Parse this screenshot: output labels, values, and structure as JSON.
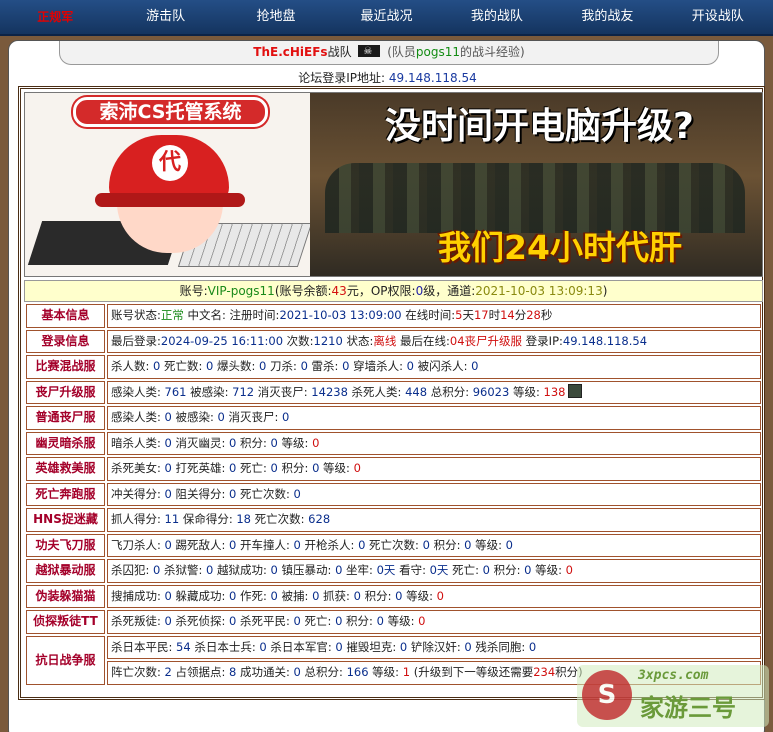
{
  "nav": [
    {
      "label": "正规军",
      "name": "nav-regular-army"
    },
    {
      "label": "游击队",
      "name": "nav-guerrilla"
    },
    {
      "label": "抢地盘",
      "name": "nav-territory"
    },
    {
      "label": "最近战况",
      "name": "nav-recent-battles"
    },
    {
      "label": "我的战队",
      "name": "nav-my-team"
    },
    {
      "label": "我的战友",
      "name": "nav-my-comrades"
    },
    {
      "label": "开设战队",
      "name": "nav-create-team"
    }
  ],
  "title": {
    "team_name": "ThE.cHiEFs",
    "team_word": "战队",
    "member_open": "(队员",
    "member": "pogs11",
    "member_close": "的战斗经验)"
  },
  "ip_line": {
    "label": "论坛登录IP地址:",
    "value": "49.148.118.54"
  },
  "banner": {
    "logo_text": "索沛CS托管系统",
    "hat_mark": "代",
    "headline": "没时间开电脑升级?",
    "subline": "我们24小时代肝"
  },
  "account": {
    "l1": "账号:",
    "acct": "VIP-pogs11",
    "l2": "(账号余额:",
    "bal": "43",
    "l3": "元，OP权限:",
    "op": "0",
    "l4": "级，通道:",
    "chan": "2021-10-03 13:09:13",
    "l5": ")"
  },
  "rows": [
    {
      "label": "基本信息",
      "parts": [
        {
          "t": "账号状态:",
          "c": ""
        },
        {
          "t": "正常",
          "c": "g"
        },
        {
          "t": " 中文名:  注册时间:",
          "c": ""
        },
        {
          "t": "2021-10-03 13:09:00",
          "c": "n"
        },
        {
          "t": " 在线时间:",
          "c": ""
        },
        {
          "t": "5",
          "c": "rd"
        },
        {
          "t": "天",
          "c": ""
        },
        {
          "t": "17",
          "c": "rd"
        },
        {
          "t": "时",
          "c": ""
        },
        {
          "t": "14",
          "c": "rd"
        },
        {
          "t": "分",
          "c": ""
        },
        {
          "t": "28",
          "c": "rd"
        },
        {
          "t": "秒",
          "c": ""
        }
      ]
    },
    {
      "label": "登录信息",
      "parts": [
        {
          "t": "最后登录:",
          "c": ""
        },
        {
          "t": "2024-09-25 16:11:00",
          "c": "n"
        },
        {
          "t": " 次数:",
          "c": ""
        },
        {
          "t": "1210",
          "c": "n"
        },
        {
          "t": " 状态:",
          "c": ""
        },
        {
          "t": "离线",
          "c": "rd"
        },
        {
          "t": " 最后在线:",
          "c": ""
        },
        {
          "t": "04丧尸升级服",
          "c": "rd"
        },
        {
          "t": " 登录IP:",
          "c": ""
        },
        {
          "t": "49.148.118.54",
          "c": "n"
        }
      ]
    },
    {
      "label": "比赛混战服",
      "parts": [
        {
          "t": "杀人数:",
          "c": ""
        },
        {
          "t": " 0",
          "c": "n"
        },
        {
          "t": " 死亡数:",
          "c": ""
        },
        {
          "t": " 0",
          "c": "n"
        },
        {
          "t": " 爆头数:",
          "c": ""
        },
        {
          "t": " 0",
          "c": "n"
        },
        {
          "t": " 刀杀:",
          "c": ""
        },
        {
          "t": " 0",
          "c": "n"
        },
        {
          "t": " 雷杀:",
          "c": ""
        },
        {
          "t": " 0",
          "c": "n"
        },
        {
          "t": " 穿墙杀人:",
          "c": ""
        },
        {
          "t": " 0",
          "c": "n"
        },
        {
          "t": " 被闪杀人:",
          "c": ""
        },
        {
          "t": " 0",
          "c": "n"
        }
      ]
    },
    {
      "label": "丧尸升级服",
      "avatar": true,
      "parts": [
        {
          "t": "感染人类:",
          "c": ""
        },
        {
          "t": " 761",
          "c": "n"
        },
        {
          "t": " 被感染:",
          "c": ""
        },
        {
          "t": " 712",
          "c": "n"
        },
        {
          "t": " 消灭丧尸:",
          "c": ""
        },
        {
          "t": " 14238",
          "c": "n"
        },
        {
          "t": " 杀死人类:",
          "c": ""
        },
        {
          "t": " 448",
          "c": "n"
        },
        {
          "t": " 总积分:",
          "c": ""
        },
        {
          "t": " 96023",
          "c": "n"
        },
        {
          "t": " 等级:",
          "c": ""
        },
        {
          "t": " 138",
          "c": "rd"
        }
      ]
    },
    {
      "label": "普通丧尸服",
      "parts": [
        {
          "t": "感染人类:",
          "c": ""
        },
        {
          "t": " 0",
          "c": "n"
        },
        {
          "t": " 被感染:",
          "c": ""
        },
        {
          "t": " 0",
          "c": "n"
        },
        {
          "t": " 消灭丧尸:",
          "c": ""
        },
        {
          "t": " 0",
          "c": "n"
        }
      ]
    },
    {
      "label": "幽灵暗杀服",
      "parts": [
        {
          "t": "暗杀人类:",
          "c": ""
        },
        {
          "t": " 0",
          "c": "n"
        },
        {
          "t": " 消灭幽灵:",
          "c": ""
        },
        {
          "t": " 0",
          "c": "n"
        },
        {
          "t": " 积分:",
          "c": ""
        },
        {
          "t": " 0",
          "c": "n"
        },
        {
          "t": " 等级:",
          "c": ""
        },
        {
          "t": " 0",
          "c": "rd"
        }
      ]
    },
    {
      "label": "英雄救美服",
      "parts": [
        {
          "t": "杀死美女:",
          "c": ""
        },
        {
          "t": " 0",
          "c": "n"
        },
        {
          "t": " 打死英雄:",
          "c": ""
        },
        {
          "t": " 0",
          "c": "n"
        },
        {
          "t": " 死亡:",
          "c": ""
        },
        {
          "t": " 0",
          "c": "n"
        },
        {
          "t": " 积分:",
          "c": ""
        },
        {
          "t": " 0",
          "c": "n"
        },
        {
          "t": " 等级:",
          "c": ""
        },
        {
          "t": " 0",
          "c": "rd"
        }
      ]
    },
    {
      "label": "死亡奔跑服",
      "parts": [
        {
          "t": "冲关得分:",
          "c": ""
        },
        {
          "t": " 0",
          "c": "n"
        },
        {
          "t": " 阻关得分:",
          "c": ""
        },
        {
          "t": " 0",
          "c": "n"
        },
        {
          "t": " 死亡次数:",
          "c": ""
        },
        {
          "t": " 0",
          "c": "n"
        }
      ]
    },
    {
      "label": "HNS捉迷藏",
      "parts": [
        {
          "t": "抓人得分:",
          "c": ""
        },
        {
          "t": " 11",
          "c": "n"
        },
        {
          "t": " 保命得分:",
          "c": ""
        },
        {
          "t": " 18",
          "c": "n"
        },
        {
          "t": " 死亡次数:",
          "c": ""
        },
        {
          "t": " 628",
          "c": "n"
        }
      ]
    },
    {
      "label": "功夫飞刀服",
      "parts": [
        {
          "t": "飞刀杀人:",
          "c": ""
        },
        {
          "t": " 0",
          "c": "n"
        },
        {
          "t": " 踢死敌人:",
          "c": ""
        },
        {
          "t": " 0",
          "c": "n"
        },
        {
          "t": " 开车撞人:",
          "c": ""
        },
        {
          "t": " 0",
          "c": "n"
        },
        {
          "t": " 开枪杀人:",
          "c": ""
        },
        {
          "t": " 0",
          "c": "n"
        },
        {
          "t": " 死亡次数:",
          "c": ""
        },
        {
          "t": " 0",
          "c": "n"
        },
        {
          "t": " 积分:",
          "c": ""
        },
        {
          "t": " 0",
          "c": "n"
        },
        {
          "t": " 等级:",
          "c": ""
        },
        {
          "t": " 0",
          "c": "n"
        }
      ]
    },
    {
      "label": "越狱暴动服",
      "parts": [
        {
          "t": "杀囚犯:",
          "c": ""
        },
        {
          "t": " 0",
          "c": "n"
        },
        {
          "t": " 杀狱警:",
          "c": ""
        },
        {
          "t": " 0",
          "c": "n"
        },
        {
          "t": " 越狱成功:",
          "c": ""
        },
        {
          "t": " 0",
          "c": "n"
        },
        {
          "t": " 镇压暴动:",
          "c": ""
        },
        {
          "t": " 0",
          "c": "n"
        },
        {
          "t": " 坐牢:",
          "c": ""
        },
        {
          "t": " 0天",
          "c": "n"
        },
        {
          "t": " 看守:",
          "c": ""
        },
        {
          "t": " 0天",
          "c": "n"
        },
        {
          "t": " 死亡:",
          "c": ""
        },
        {
          "t": " 0",
          "c": "n"
        },
        {
          "t": " 积分:",
          "c": ""
        },
        {
          "t": " 0",
          "c": "n"
        },
        {
          "t": " 等级:",
          "c": ""
        },
        {
          "t": " 0",
          "c": "rd"
        }
      ]
    },
    {
      "label": "伪装躲猫猫",
      "parts": [
        {
          "t": "搜捕成功:",
          "c": ""
        },
        {
          "t": " 0",
          "c": "n"
        },
        {
          "t": " 躲藏成功:",
          "c": ""
        },
        {
          "t": " 0",
          "c": "n"
        },
        {
          "t": " 作死:",
          "c": ""
        },
        {
          "t": " 0",
          "c": "n"
        },
        {
          "t": " 被捕:",
          "c": ""
        },
        {
          "t": " 0",
          "c": "n"
        },
        {
          "t": " 抓获:",
          "c": ""
        },
        {
          "t": " 0",
          "c": "n"
        },
        {
          "t": " 积分:",
          "c": ""
        },
        {
          "t": " 0",
          "c": "n"
        },
        {
          "t": " 等级:",
          "c": ""
        },
        {
          "t": " 0",
          "c": "rd"
        }
      ]
    },
    {
      "label": "侦探叛徒TT",
      "parts": [
        {
          "t": "杀死叛徒:",
          "c": ""
        },
        {
          "t": " 0",
          "c": "n"
        },
        {
          "t": " 杀死侦探:",
          "c": ""
        },
        {
          "t": " 0",
          "c": "n"
        },
        {
          "t": " 杀死平民:",
          "c": ""
        },
        {
          "t": " 0",
          "c": "n"
        },
        {
          "t": " 死亡:",
          "c": ""
        },
        {
          "t": " 0",
          "c": "n"
        },
        {
          "t": " 积分:",
          "c": ""
        },
        {
          "t": " 0",
          "c": "n"
        },
        {
          "t": " 等级:",
          "c": ""
        },
        {
          "t": " 0",
          "c": "rd"
        }
      ]
    },
    {
      "label": "抗日战争服",
      "double": true,
      "parts": [
        {
          "t": "杀日本平民:",
          "c": ""
        },
        {
          "t": " 54",
          "c": "n"
        },
        {
          "t": " 杀日本士兵:",
          "c": ""
        },
        {
          "t": " 0",
          "c": "n"
        },
        {
          "t": " 杀日本军官:",
          "c": ""
        },
        {
          "t": " 0",
          "c": "n"
        },
        {
          "t": " 摧毁坦克:",
          "c": ""
        },
        {
          "t": " 0",
          "c": "n"
        },
        {
          "t": " 铲除汉奸:",
          "c": ""
        },
        {
          "t": " 0",
          "c": "n"
        },
        {
          "t": " 残杀同胞:",
          "c": ""
        },
        {
          "t": " 0",
          "c": "n"
        }
      ],
      "parts2": [
        {
          "t": "阵亡次数:",
          "c": ""
        },
        {
          "t": " 2",
          "c": "n"
        },
        {
          "t": " 占领据点:",
          "c": ""
        },
        {
          "t": " 8",
          "c": "n"
        },
        {
          "t": " 成功通关:",
          "c": ""
        },
        {
          "t": " 0",
          "c": "n"
        },
        {
          "t": " 总积分:",
          "c": ""
        },
        {
          "t": " 166",
          "c": "n"
        },
        {
          "t": " 等级:",
          "c": ""
        },
        {
          "t": " 1",
          "c": "rd"
        },
        {
          "t": " (升级到下一等级还需要",
          "c": ""
        },
        {
          "t": "234",
          "c": "rd"
        },
        {
          "t": "积分)",
          "c": ""
        }
      ]
    }
  ],
  "watermark": {
    "mark": "S",
    "top": "3xpcs.com",
    "bottom": "家游三号"
  },
  "colors": {
    "nav_bg": "#244e86",
    "label_red": "#a4002a",
    "value_blue": "#0a2e8c",
    "accent_red": "#d01010",
    "account_bg": "#ffffcc",
    "page_bg": "#7a5a3c"
  }
}
